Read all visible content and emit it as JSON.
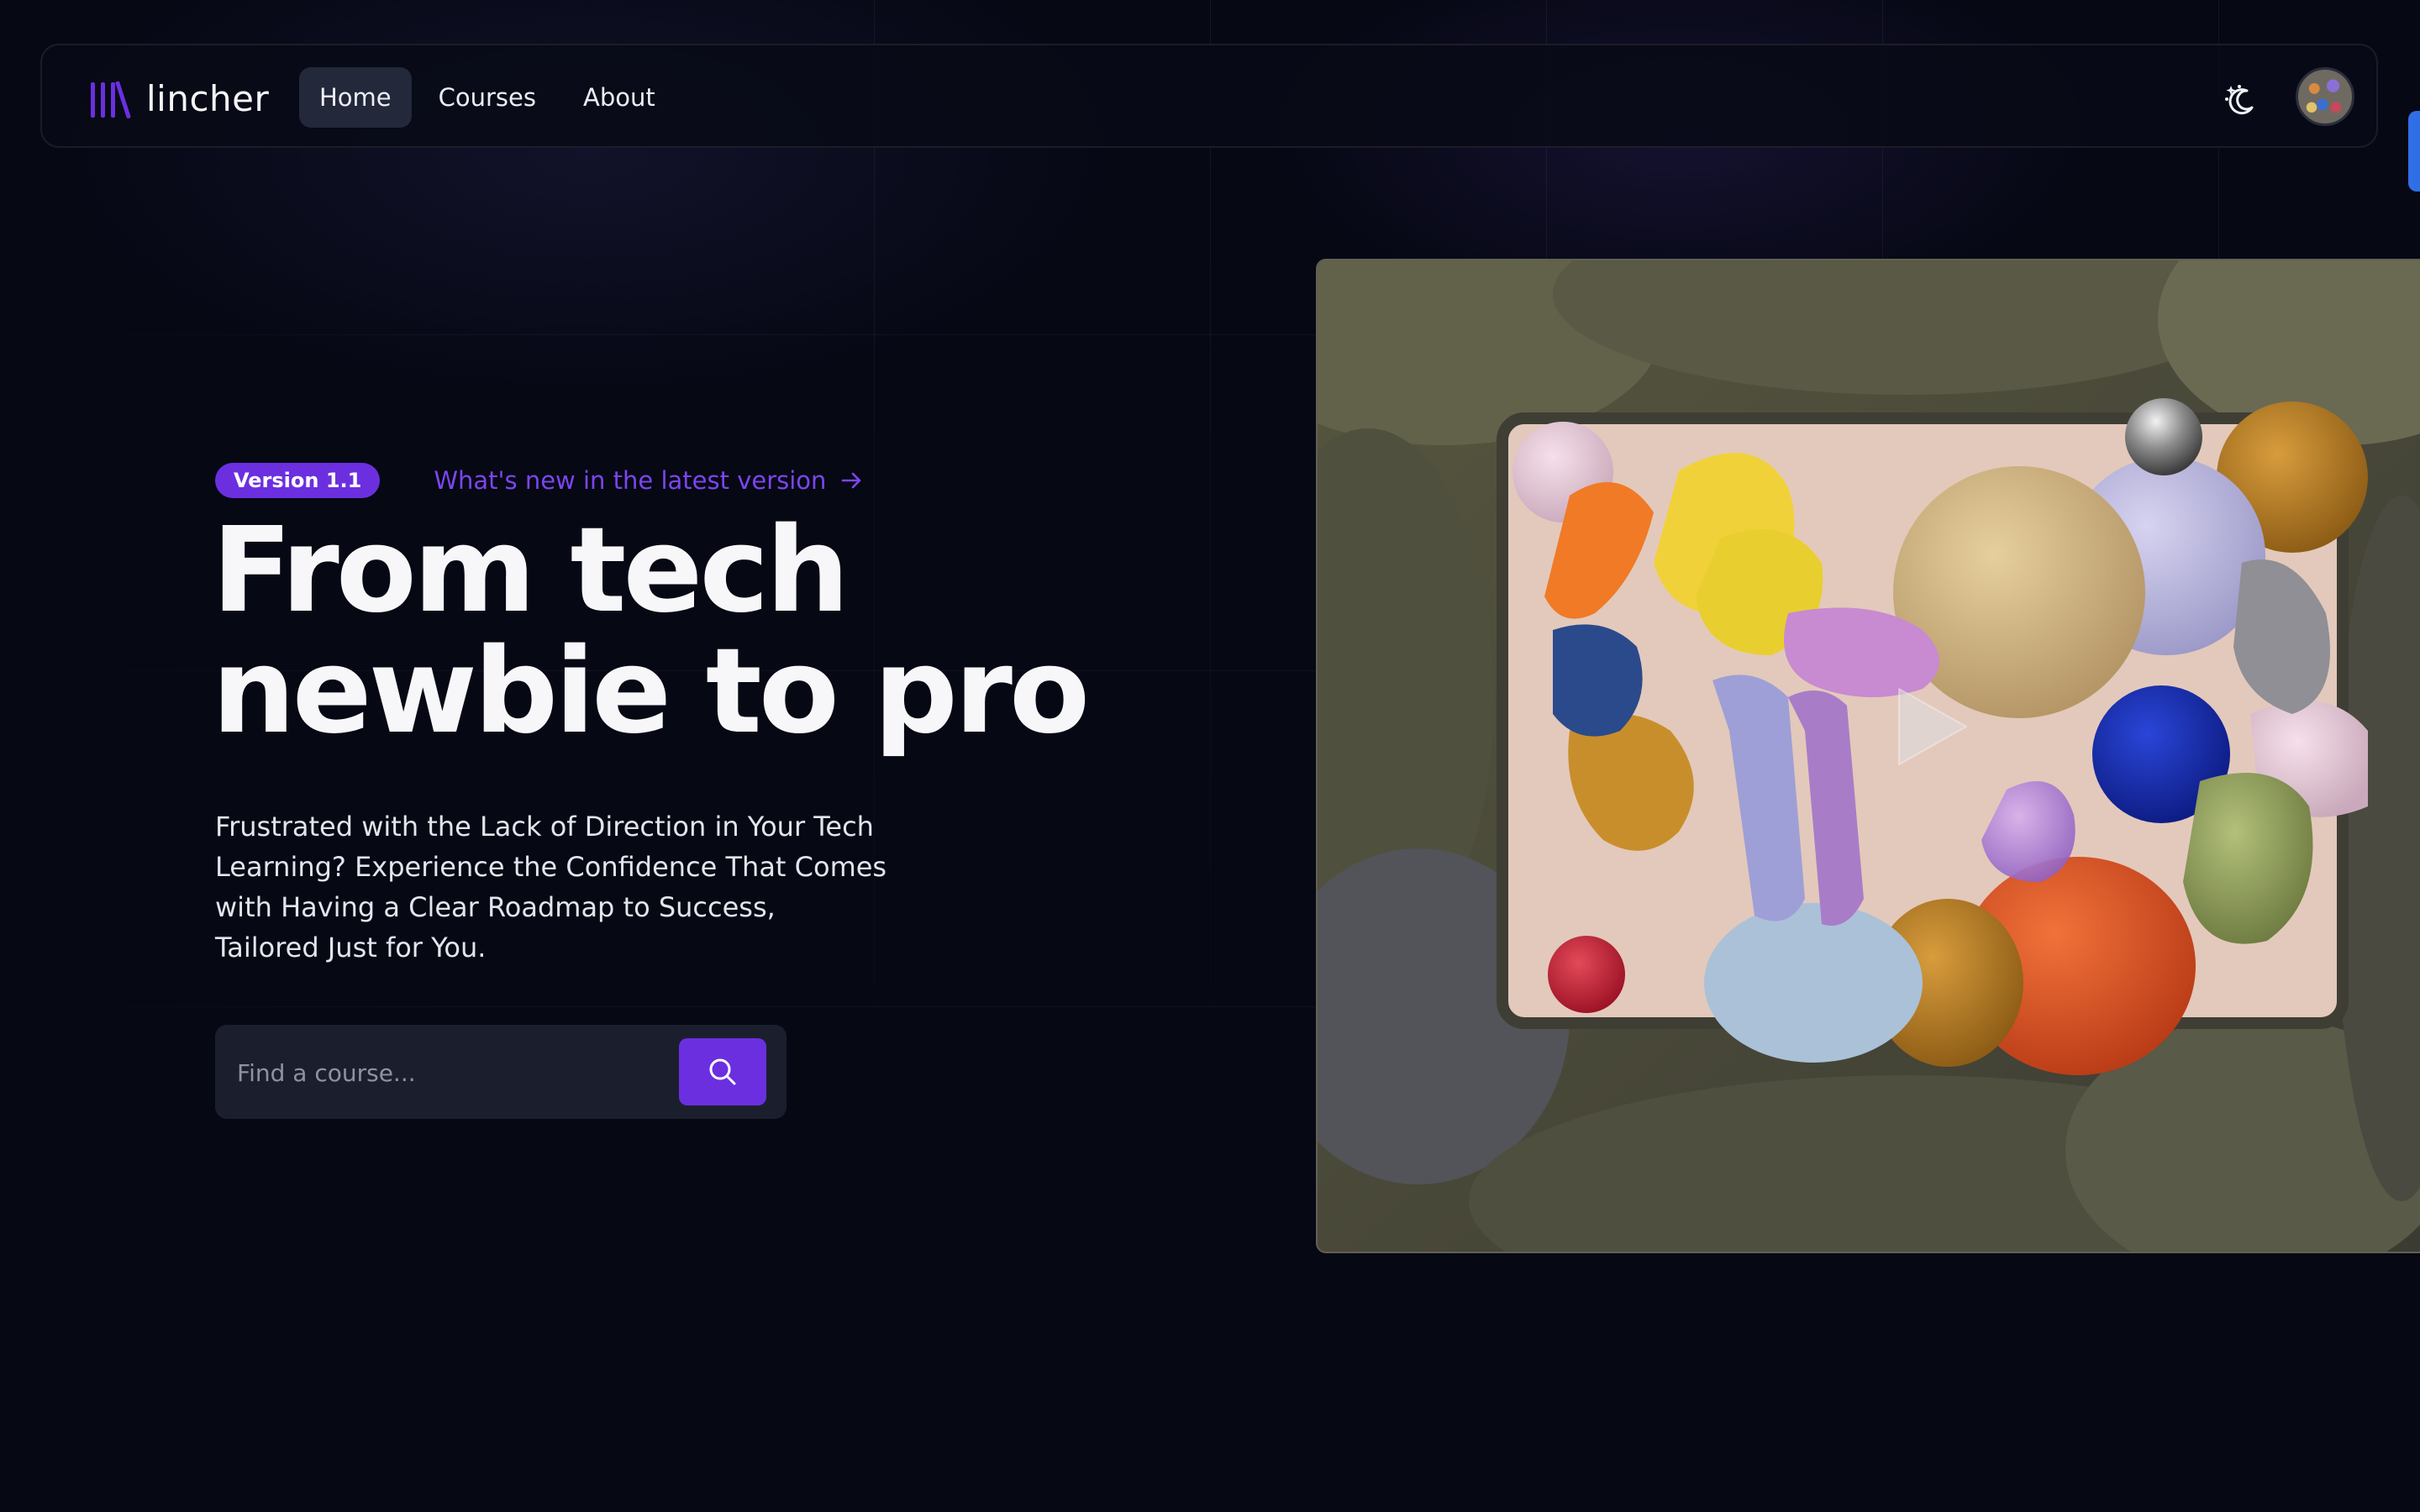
{
  "app": {
    "brand_name": "lincher",
    "brand_color": "#6b2fe0"
  },
  "nav": {
    "items": [
      {
        "label": "Home",
        "active": true
      },
      {
        "label": "Courses",
        "active": false
      },
      {
        "label": "About",
        "active": false
      }
    ],
    "theme_toggle_icon": "moon-stars-icon",
    "avatar_icon": "user-avatar"
  },
  "hero": {
    "badge": "Version 1.1",
    "whats_new_link": "What's new in the latest version",
    "headline_line1": "From tech",
    "headline_line2": "newbie to pro",
    "subtitle": "Frustrated with the Lack of Direction in Your Tech Learning? Experience the Confidence That Comes with Having a Clear Roadmap to Success, Tailored Just for You.",
    "search": {
      "placeholder": "Find a course...",
      "value": "",
      "button_icon": "search-icon"
    }
  },
  "media": {
    "type": "video-preview",
    "play_icon": "play-icon"
  },
  "colors": {
    "background": "#060814",
    "accent": "#6b2fe0",
    "link": "#7b45ee",
    "nav_active_bg": "#23283a",
    "edge_tab": "#2f6fe6"
  }
}
